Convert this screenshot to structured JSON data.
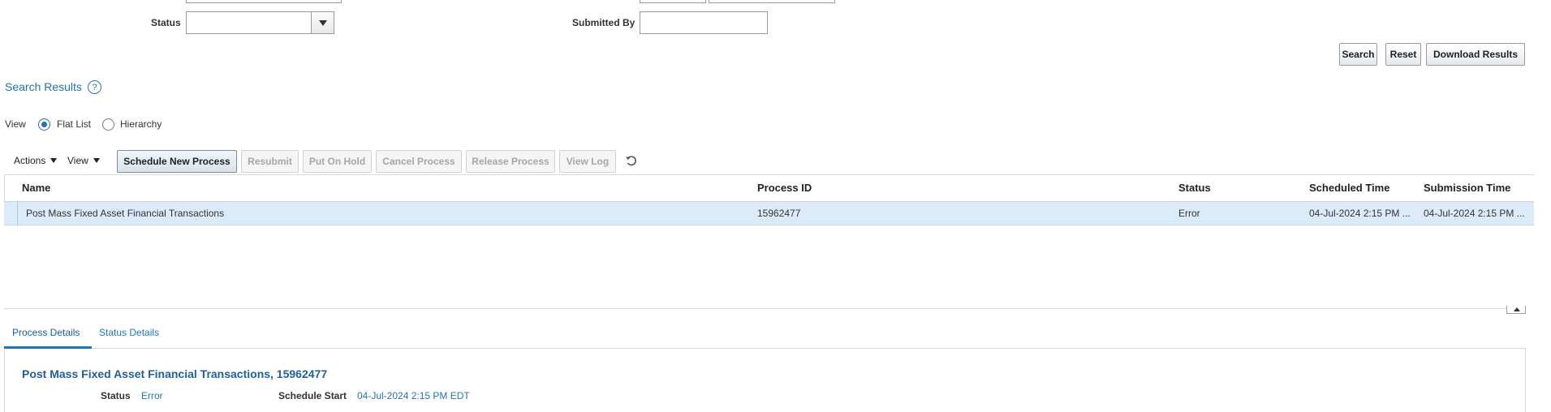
{
  "search_form": {
    "status_label": "Status",
    "status_value": "",
    "submitted_by_label": "Submitted By",
    "submitted_by_value": "",
    "search_label": "Search",
    "reset_label": "Reset",
    "download_label": "Download Results"
  },
  "results": {
    "title": "Search Results",
    "help_glyph": "?",
    "view_label": "View",
    "flat_list_label": "Flat List",
    "hierarchy_label": "Hierarchy",
    "selected_view": "Flat List"
  },
  "toolbar": {
    "actions_label": "Actions",
    "view_label": "View",
    "schedule_label": "Schedule New Process",
    "resubmit_label": "Resubmit",
    "put_on_hold_label": "Put On Hold",
    "cancel_label": "Cancel Process",
    "release_label": "Release Process",
    "view_log_label": "View Log",
    "refresh_icon": "refresh-icon"
  },
  "table": {
    "columns": [
      "Name",
      "Process ID",
      "Status",
      "Scheduled Time",
      "Submission Time"
    ],
    "rows": [
      {
        "name": "Post Mass Fixed Asset Financial Transactions",
        "process_id": "15962477",
        "status": "Error",
        "scheduled_time": "04-Jul-2024 2:15 PM ...",
        "submission_time": "04-Jul-2024 2:15 PM ..."
      }
    ]
  },
  "details": {
    "tabs": [
      "Process Details",
      "Status Details"
    ],
    "active_tab": "Process Details",
    "title": "Post Mass Fixed Asset Financial Transactions, 15962477",
    "status_label": "Status",
    "status_value": "Error",
    "schedule_start_label": "Schedule Start",
    "schedule_start_value": "04-Jul-2024 2:15 PM EDT"
  },
  "colors": {
    "link": "#2273b8",
    "selected_row": "#dcebfa",
    "radio_selected": "#2a6ab7"
  }
}
